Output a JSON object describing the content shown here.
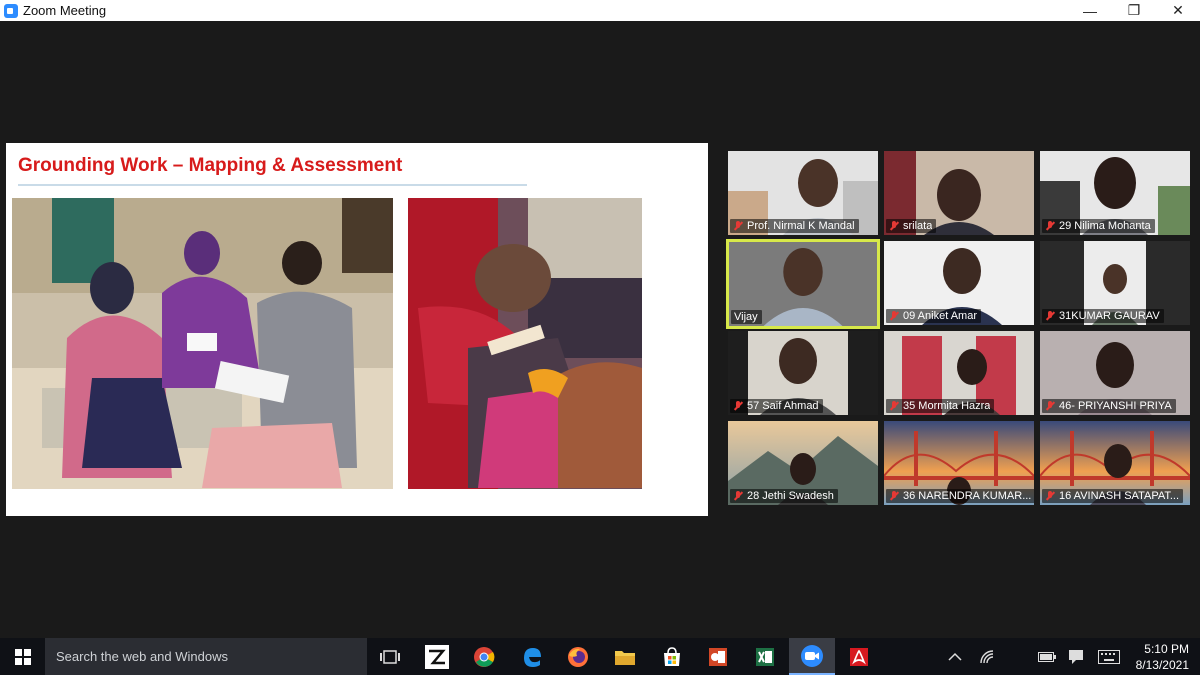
{
  "window": {
    "title": "Zoom Meeting",
    "minimize": "—",
    "maximize": "❐",
    "close": "✕"
  },
  "slide": {
    "title": "Grounding Work – Mapping & Assessment"
  },
  "participants": [
    {
      "name": "Prof. Nirmal K Mandal",
      "muted": true,
      "active": false
    },
    {
      "name": "srilata",
      "muted": true,
      "active": false
    },
    {
      "name": "29 Nilima Mohanta",
      "muted": true,
      "active": false
    },
    {
      "name": "Vijay",
      "muted": false,
      "active": true
    },
    {
      "name": "09 Aniket Amar",
      "muted": true,
      "active": false
    },
    {
      "name": "31KUMAR GAURAV",
      "muted": true,
      "active": false
    },
    {
      "name": "57 Saif Ahmad",
      "muted": true,
      "active": false
    },
    {
      "name": "35 Mormita Hazra",
      "muted": true,
      "active": false
    },
    {
      "name": "46- PRIYANSHI PRIYA",
      "muted": true,
      "active": false
    },
    {
      "name": "28 Jethi Swadesh",
      "muted": true,
      "active": false
    },
    {
      "name": "36 NARENDRA KUMAR...",
      "muted": true,
      "active": false
    },
    {
      "name": "16 AVINASH SATAPAT...",
      "muted": true,
      "active": false
    }
  ],
  "taskbar": {
    "search_placeholder": "Search the web and Windows",
    "time": "5:10 PM",
    "date": "8/13/2021"
  }
}
